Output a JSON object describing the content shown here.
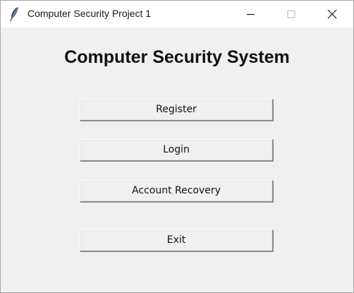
{
  "window": {
    "title": "Computer Security Project 1",
    "icon": "feather-icon",
    "controls": {
      "minimize_icon": "minimize-icon",
      "maximize_icon": "maximize-icon",
      "close_icon": "close-icon"
    }
  },
  "main": {
    "heading": "Computer Security System",
    "buttons": [
      {
        "label": "Register"
      },
      {
        "label": "Login"
      },
      {
        "label": "Account Recovery"
      },
      {
        "label": "Exit"
      }
    ]
  },
  "colors": {
    "titlebar_bg": "#ffffff",
    "window_bg": "#f0f0f0",
    "text": "#111111"
  }
}
